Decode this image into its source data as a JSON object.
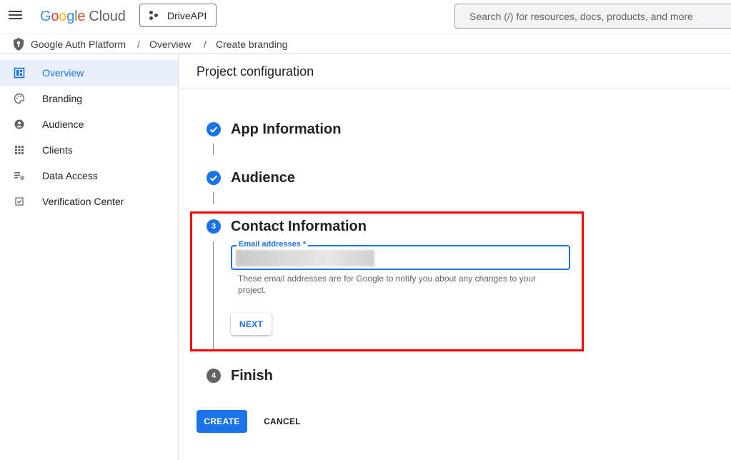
{
  "topbar": {
    "logo_google": [
      "G",
      "o",
      "o",
      "g",
      "l",
      "e"
    ],
    "logo_cloud": "Cloud",
    "project": "DriveAPI",
    "search_placeholder": "Search (/) for resources, docs, products, and more"
  },
  "breadcrumb": {
    "items": [
      "Google Auth Platform",
      "Overview",
      "Create branding"
    ],
    "separator": "/"
  },
  "sidebar": {
    "items": [
      {
        "label": "Overview",
        "icon": "dashboard-icon",
        "active": true
      },
      {
        "label": "Branding",
        "icon": "palette-icon"
      },
      {
        "label": "Audience",
        "icon": "account-circle-icon"
      },
      {
        "label": "Clients",
        "icon": "apps-grid-icon"
      },
      {
        "label": "Data Access",
        "icon": "settings-list-icon"
      },
      {
        "label": "Verification Center",
        "icon": "checkbox-icon"
      }
    ]
  },
  "main": {
    "title": "Project configuration",
    "steps": [
      {
        "title": "App Information",
        "state": "done"
      },
      {
        "title": "Audience",
        "state": "done"
      },
      {
        "title": "Contact Information",
        "state": "active",
        "number": "3"
      },
      {
        "title": "Finish",
        "state": "pending",
        "number": "4"
      }
    ],
    "email_field": {
      "label": "Email addresses *",
      "helper": "These email addresses are for Google to notify you about any changes to your project."
    },
    "next_label": "NEXT",
    "create_label": "CREATE",
    "cancel_label": "CANCEL"
  },
  "colors": {
    "accent": "#1a73e8",
    "highlight": "#ff0000"
  }
}
